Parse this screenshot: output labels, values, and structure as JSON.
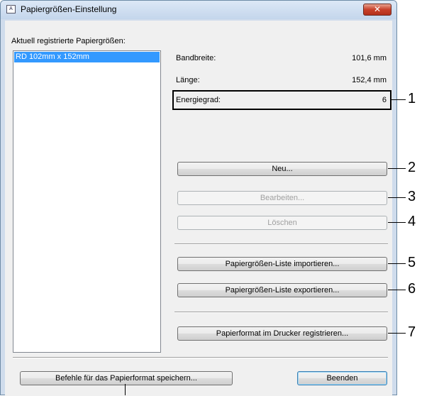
{
  "window": {
    "title": "Papiergrößen-Einstellung",
    "app_icon_glyph": "A",
    "close_label": "✕"
  },
  "list": {
    "label": "Aktuell registrierte Papiergrößen:",
    "items": [
      "RD 102mm x 152mm"
    ]
  },
  "properties": {
    "width_label": "Bandbreite:",
    "width_value": "101,6 mm",
    "length_label": "Länge:",
    "length_value": "152,4 mm",
    "energy_label": "Energiegrad:",
    "energy_value": "6"
  },
  "buttons": {
    "new": "Neu...",
    "edit": "Bearbeiten...",
    "delete": "Löschen",
    "import_list": "Papiergrößen-Liste importieren...",
    "export_list": "Papiergrößen-Liste exportieren...",
    "register_printer": "Papierformat im Drucker registrieren...",
    "save_commands": "Befehle für das Papierformat speichern...",
    "close": "Beenden"
  },
  "callouts": [
    "1",
    "2",
    "3",
    "4",
    "5",
    "6",
    "7"
  ]
}
